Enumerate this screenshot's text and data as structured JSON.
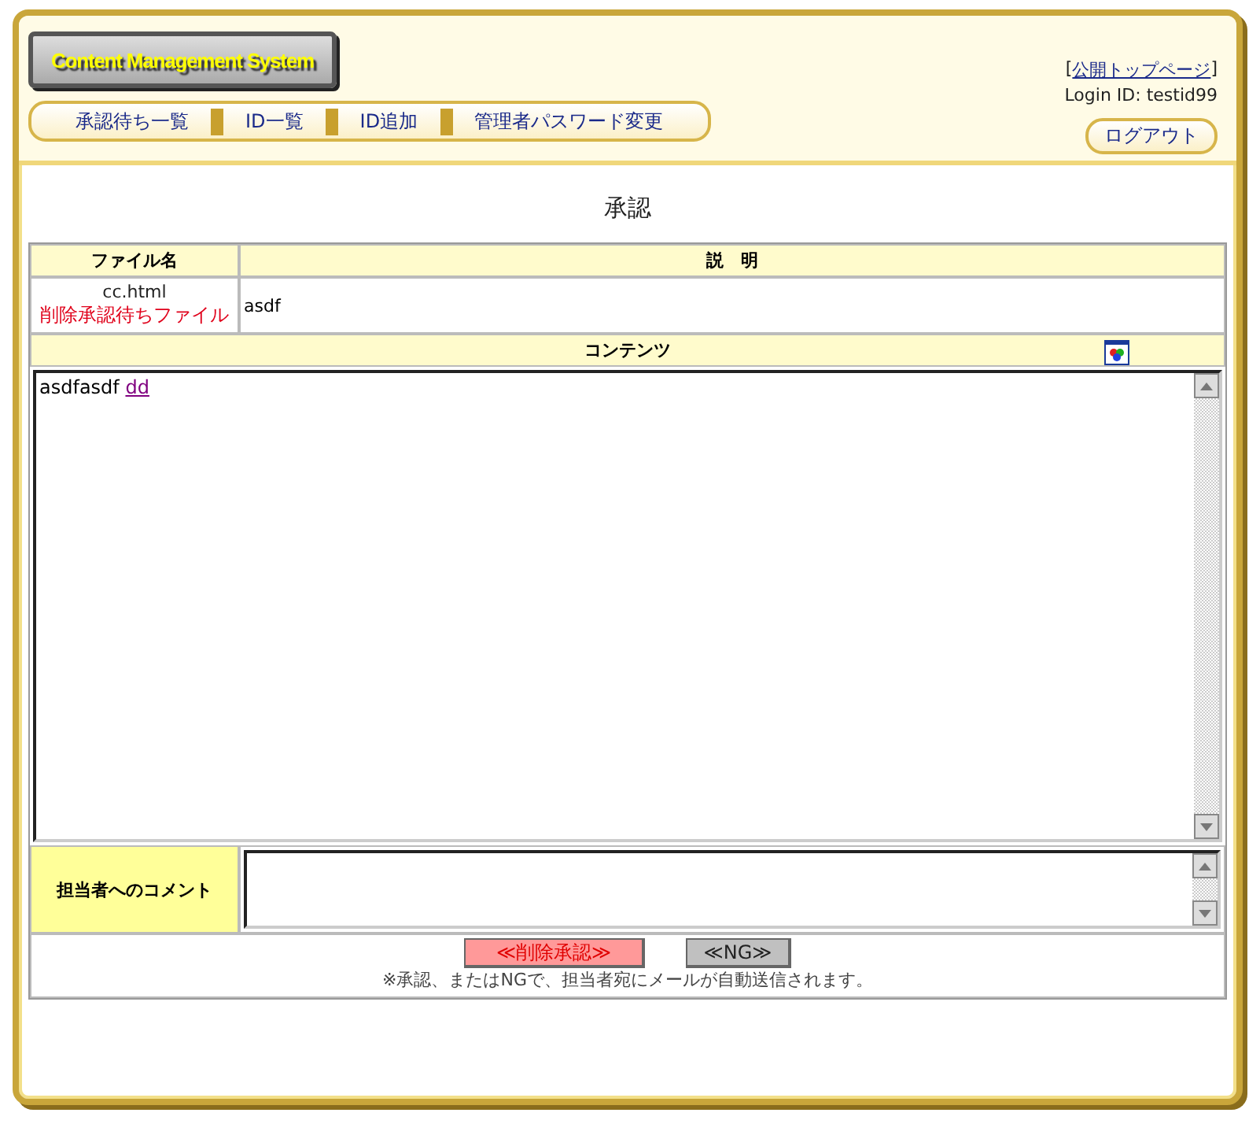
{
  "header": {
    "logo": "Content Management System",
    "nav": [
      {
        "label": "承認待ち一覧"
      },
      {
        "label": "ID一覧"
      },
      {
        "label": "ID追加"
      },
      {
        "label": "管理者パスワード変更"
      }
    ],
    "top_link_open": "[",
    "top_link": "公開トップページ",
    "top_link_close": "]",
    "login": "Login ID: testid99",
    "logout": "ログアウト"
  },
  "page_title": "承認",
  "columns": [
    "ファイル名",
    "説　明"
  ],
  "file": {
    "name": "cc.html",
    "status": "削除承認待ちファイル",
    "description": "asdf"
  },
  "content": {
    "label": "コンテンツ",
    "text": "asdfasdf",
    "link": "dd"
  },
  "comment": {
    "label": "担当者へのコメント"
  },
  "buttons": [
    {
      "label": "≪削除承認≫",
      "kind": "approve"
    },
    {
      "label": "≪NG≫",
      "kind": "reject"
    }
  ],
  "note": "※承認、またはNGで、担当者宛にメールが自動送信されます。"
}
